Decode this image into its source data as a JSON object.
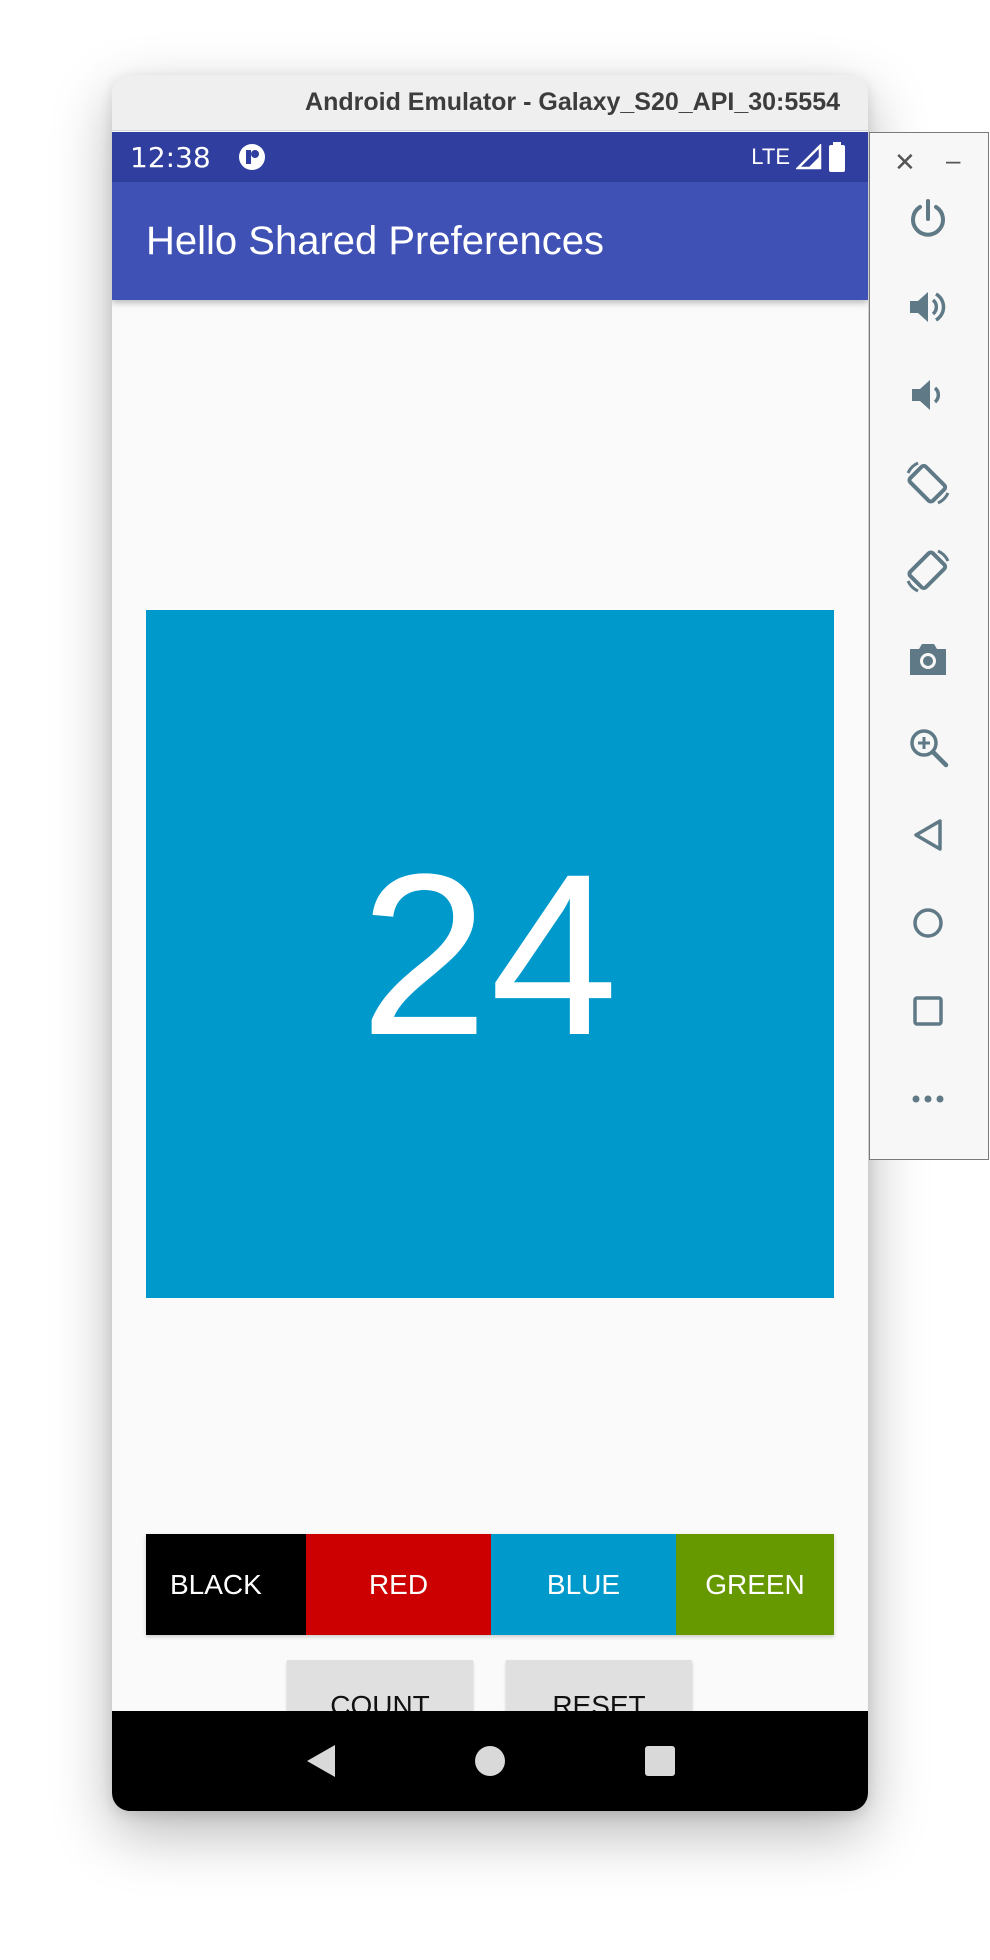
{
  "window": {
    "title": "Android Emulator - Galaxy_S20_API_30:5554"
  },
  "status_bar": {
    "time": "12:38",
    "network": "LTE"
  },
  "app_bar": {
    "title": "Hello Shared Preferences"
  },
  "counter": {
    "value": "24"
  },
  "color_buttons": [
    {
      "label": "BLACK",
      "color": "#000000"
    },
    {
      "label": "RED",
      "color": "#cc0000"
    },
    {
      "label": "BLUE",
      "color": "#0099cc"
    },
    {
      "label": "GREEN",
      "color": "#669900"
    }
  ],
  "action_buttons": {
    "count": "COUNT",
    "reset": "RESET"
  },
  "colors": {
    "status_bar": "#303f9f",
    "app_bar": "#3f51b5",
    "counter_background": "#0099cc",
    "icon_gray": "#5f7a86"
  },
  "sidebar_tools": [
    "power-icon",
    "volume-up-icon",
    "volume-down-icon",
    "rotate-left-icon",
    "rotate-right-icon",
    "camera-icon",
    "zoom-icon",
    "back-icon",
    "home-icon",
    "overview-icon",
    "more-icon"
  ]
}
